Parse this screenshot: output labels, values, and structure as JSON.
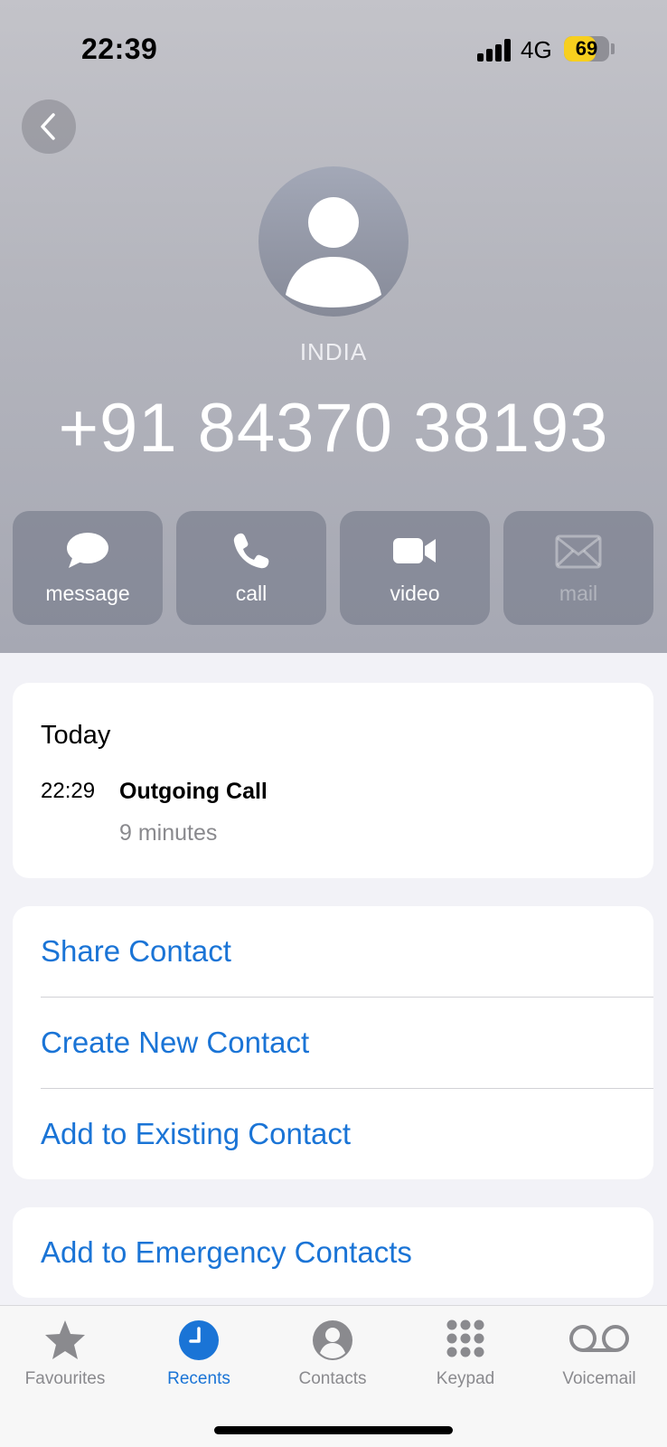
{
  "status_bar": {
    "time": "22:39",
    "network": "4G",
    "battery": "69",
    "battery_level": 0.69
  },
  "header": {
    "back_icon": "chevron-left-icon",
    "country": "INDIA",
    "phone_number": "+91 84370 38193"
  },
  "actions": [
    {
      "label": "message",
      "icon": "message-bubble-icon",
      "enabled": true
    },
    {
      "label": "call",
      "icon": "phone-icon",
      "enabled": true
    },
    {
      "label": "video",
      "icon": "video-camera-icon",
      "enabled": true
    },
    {
      "label": "mail",
      "icon": "envelope-icon",
      "enabled": false
    }
  ],
  "call_history": {
    "day": "Today",
    "entries": [
      {
        "time": "22:29",
        "type": "Outgoing Call",
        "duration": "9 minutes"
      }
    ]
  },
  "contact_actions": [
    "Share Contact",
    "Create New Contact",
    "Add to Existing Contact"
  ],
  "emergency_action": "Add to Emergency Contacts",
  "tab_bar": {
    "tabs": [
      {
        "label": "Favourites",
        "icon": "star-icon",
        "active": false
      },
      {
        "label": "Recents",
        "icon": "clock-icon",
        "active": true
      },
      {
        "label": "Contacts",
        "icon": "person-circle-icon",
        "active": false
      },
      {
        "label": "Keypad",
        "icon": "keypad-icon",
        "active": false
      },
      {
        "label": "Voicemail",
        "icon": "voicemail-icon",
        "active": false
      }
    ]
  },
  "colors": {
    "accent": "#1a74d6",
    "battery": "#f7cf1e",
    "inactive": "#8a8a8e"
  }
}
